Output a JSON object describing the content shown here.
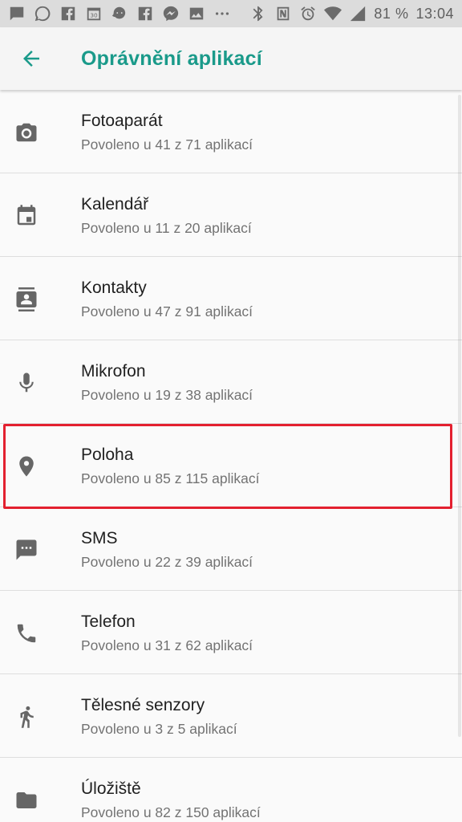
{
  "status_bar": {
    "battery": "81 %",
    "time": "13:04",
    "left_icons": [
      "message-icon",
      "whatsapp-icon",
      "facebook-icon",
      "calendar-30-icon",
      "waze-icon",
      "facebook-icon",
      "messenger-icon",
      "image-icon",
      "more-icon"
    ],
    "right_icons": [
      "bluetooth-icon",
      "nfc-icon",
      "alarm-icon",
      "wifi-icon",
      "signal-icon",
      "battery-icon"
    ]
  },
  "app_bar": {
    "title": "Oprávnění aplikací"
  },
  "permissions": [
    {
      "icon": "camera-icon",
      "title": "Fotoaparát",
      "subtitle": "Povoleno u 41 z 71 aplikací"
    },
    {
      "icon": "calendar-icon",
      "title": "Kalendář",
      "subtitle": "Povoleno u 11 z 20 aplikací"
    },
    {
      "icon": "contacts-icon",
      "title": "Kontakty",
      "subtitle": "Povoleno u 47 z 91 aplikací"
    },
    {
      "icon": "microphone-icon",
      "title": "Mikrofon",
      "subtitle": "Povoleno u 19 z 38 aplikací"
    },
    {
      "icon": "location-icon",
      "title": "Poloha",
      "subtitle": "Povoleno u 85 z 115 aplikací"
    },
    {
      "icon": "sms-icon",
      "title": "SMS",
      "subtitle": "Povoleno u 22 z 39 aplikací"
    },
    {
      "icon": "phone-icon",
      "title": "Telefon",
      "subtitle": "Povoleno u 31 z 62 aplikací"
    },
    {
      "icon": "body-sensors-icon",
      "title": "Tělesné senzory",
      "subtitle": "Povoleno u 3 z 5 aplikací"
    },
    {
      "icon": "storage-icon",
      "title": "Úložiště",
      "subtitle": "Povoleno u 82 z 150 aplikací"
    }
  ],
  "highlighted_item": "Poloha",
  "colors": {
    "accent": "#1a9a8a",
    "highlight": "#e3202f"
  }
}
